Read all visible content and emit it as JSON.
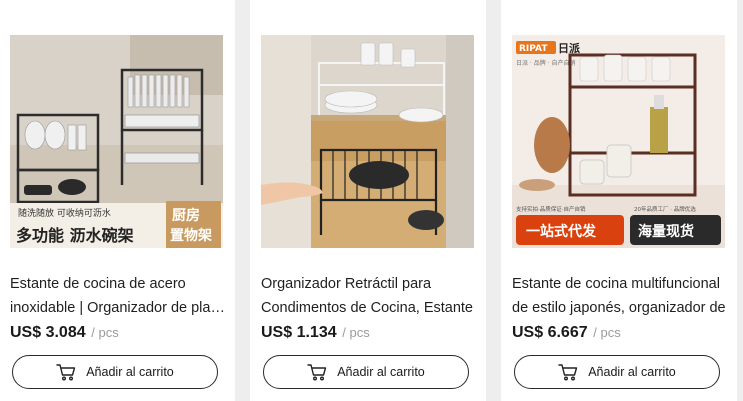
{
  "products": [
    {
      "title_line1": "Estante de cocina de acero",
      "title_line2": "inoxidable | Organizador de platos",
      "price": "US$ 3.084",
      "unit": "/ pcs",
      "button_label": "Añadir al carrito",
      "image_text": {
        "banner_small": "随洗随放 可收纳可沥水",
        "banner_big": "多功能 沥水碗架",
        "badge_line1": "厨房",
        "badge_line2": "置物架"
      }
    },
    {
      "title_line1": "Organizador Retráctil para",
      "title_line2": "Condimentos de Cocina, Estante",
      "price": "US$ 1.134",
      "unit": "/ pcs",
      "button_label": "Añadir al carrito",
      "image_text": {}
    },
    {
      "title_line1": "Estante de cocina multifuncional",
      "title_line2": "de estilo japonés, organizador de",
      "price": "US$ 6.667",
      "unit": "/ pcs",
      "button_label": "Añadir al carrito",
      "image_text": {
        "brand": "RIPAT",
        "brand_suffix": "日派",
        "tagline": "日派 · 品牌 · 自产自销",
        "bottom_small_left": "支持实拍·品质保证·自产自销",
        "bottom_small_right": "20年品质工厂 · 品牌优选",
        "btn_left": "一站式代发",
        "btn_right": "海量现货"
      }
    }
  ]
}
